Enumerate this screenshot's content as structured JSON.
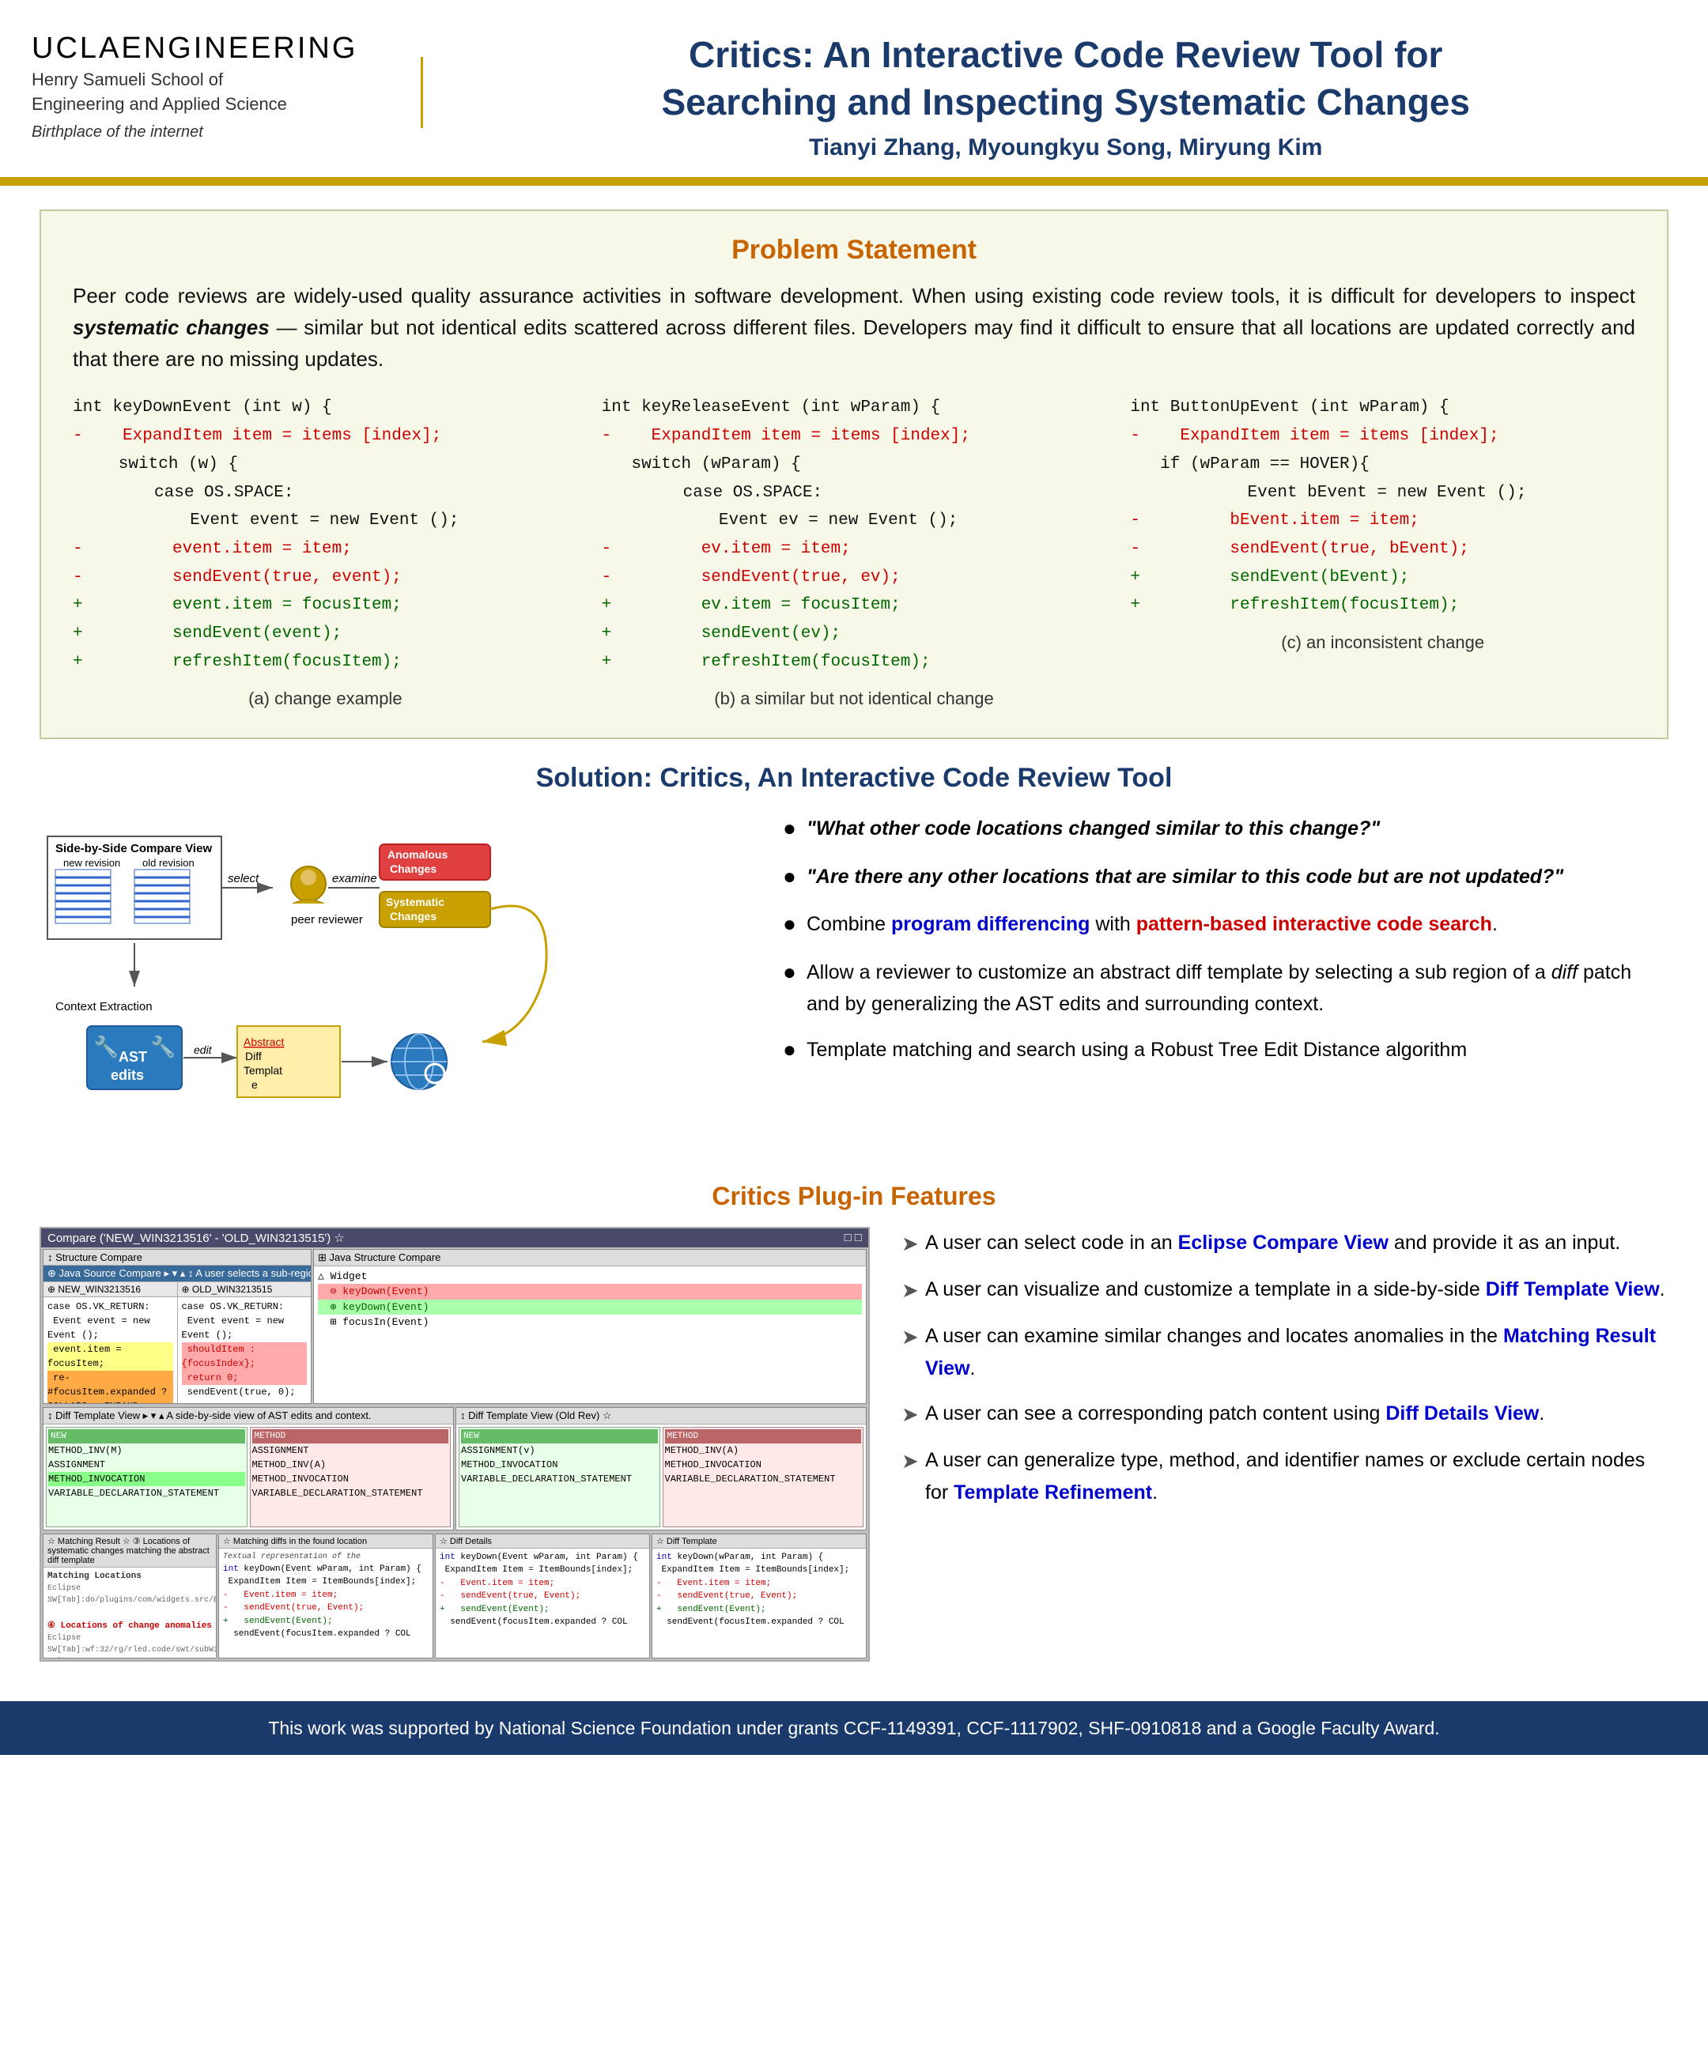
{
  "header": {
    "ucla_text": "UCLA",
    "engineering_text": "ENGINEERING",
    "school_line1": "Henry Samueli School of",
    "school_line2": "Engineering and Applied Science",
    "tagline": "Birthplace of the internet",
    "paper_title_line1": "Critics: An Interactive Code Review Tool for",
    "paper_title_line2": "Searching and Inspecting Systematic Changes",
    "authors": "Tianyi Zhang, Myoungkyu Song, Miryung Kim"
  },
  "problem_statement": {
    "section_title": "Problem Statement",
    "text": "Peer code reviews are widely-used quality assurance activities in software development. When using existing code review tools, it is difficult for developers to inspect systematic changes — similar but not identical edits scattered across different files. Developers may find it difficult to ensure that all locations are updated correctly and that there are no missing updates.",
    "code_block_a": {
      "caption": "(a) change example",
      "lines": [
        {
          "text": "int keyDownEvent (int w) {",
          "style": "normal"
        },
        {
          "text": "-   ExpandItem item = items [index];",
          "style": "deleted"
        },
        {
          "text": "    switch (w) {",
          "style": "normal"
        },
        {
          "text": "        case OS.SPACE:",
          "style": "normal"
        },
        {
          "text": "            Event event = new Event ();",
          "style": "normal"
        },
        {
          "text": "-           event.item = item;",
          "style": "deleted"
        },
        {
          "text": "-           sendEvent(true, event);",
          "style": "deleted"
        },
        {
          "text": "+           event.item = focusItem;",
          "style": "added"
        },
        {
          "text": "+           sendEvent(event);",
          "style": "added"
        },
        {
          "text": "+           refreshItem(focusItem);",
          "style": "added"
        }
      ]
    },
    "code_block_b": {
      "caption": "(b) a similar but not identical change",
      "lines": [
        {
          "text": "int keyReleaseEvent (int wParam) {",
          "style": "normal"
        },
        {
          "text": "-   ExpandItem item = items [index];",
          "style": "deleted"
        },
        {
          "text": "    switch (wParam) {",
          "style": "normal"
        },
        {
          "text": "        case OS.SPACE:",
          "style": "normal"
        },
        {
          "text": "            Event ev = new Event ();",
          "style": "normal"
        },
        {
          "text": "-           ev.item = item;",
          "style": "deleted"
        },
        {
          "text": "-           sendEvent(true, ev);",
          "style": "deleted"
        },
        {
          "text": "+           ev.item = focusItem;",
          "style": "added"
        },
        {
          "text": "+           sendEvent(ev);",
          "style": "added"
        },
        {
          "text": "+           refreshItem(focusItem);",
          "style": "added"
        }
      ]
    },
    "code_block_c": {
      "caption": "(c) an inconsistent change",
      "lines": [
        {
          "text": "int ButtonUpEvent (int wParam) {",
          "style": "normal"
        },
        {
          "text": "-   ExpandItem item = items [index];",
          "style": "deleted"
        },
        {
          "text": "    if (wParam == HOVER){",
          "style": "normal"
        },
        {
          "text": "        Event bEvent = new Event ();",
          "style": "normal"
        },
        {
          "text": "-       bEvent.item = item;",
          "style": "deleted"
        },
        {
          "text": "-       sendEvent(true, bEvent);",
          "style": "deleted"
        },
        {
          "text": "+       sendEvent(bEvent);",
          "style": "added"
        },
        {
          "text": "+       refreshItem(focusItem);",
          "style": "added"
        }
      ]
    }
  },
  "solution": {
    "section_title": "Solution: Critics, An Interactive Code Review Tool",
    "diagram": {
      "compare_view_label": "Side-by-Side Compare View",
      "new_revision_label": "new revision",
      "old_revision_label": "old revision",
      "select_label": "select",
      "examine_label": "examine",
      "edit_label": "edit",
      "peer_reviewer_label": "peer reviewer",
      "anomalous_label": "Anomalous\nChanges",
      "systematic_label": "Systematic\nChanges",
      "ast_edits_label": "AST\nedits",
      "abstract_diff_label": "Abstract\nDiff\nTemplat\ne",
      "context_extraction_label": "Context Extraction"
    },
    "bullets": [
      {
        "text": "\"What other code locations changed similar to this change?\"",
        "italic": true
      },
      {
        "text": "\"Are there any other locations that are similar to this code but are not updated?\"",
        "italic": true
      },
      {
        "text_parts": [
          {
            "text": "Combine ",
            "style": "normal"
          },
          {
            "text": "program differencing",
            "style": "blue"
          },
          {
            "text": " with ",
            "style": "normal"
          },
          {
            "text": "pattern-based interactive code search",
            "style": "red"
          },
          {
            "text": ".",
            "style": "normal"
          }
        ]
      },
      {
        "text": "Allow a reviewer to customize an abstract diff template by selecting a sub region of a diff patch and by generalizing the AST edits and surrounding context."
      },
      {
        "text": "Template matching and search using a Robust Tree Edit Distance algorithm"
      }
    ]
  },
  "plugin_features": {
    "section_title": "Critics Plug-in Features",
    "bullets": [
      {
        "text_parts": [
          {
            "text": "A user can select code in an ",
            "style": "normal"
          },
          {
            "text": "Eclipse Compare View",
            "style": "blue"
          },
          {
            "text": " and provide it as an input.",
            "style": "normal"
          }
        ]
      },
      {
        "text_parts": [
          {
            "text": "A user can visualize and customize a template in a side-by-side ",
            "style": "normal"
          },
          {
            "text": "Diff Template View",
            "style": "blue"
          },
          {
            "text": ".",
            "style": "normal"
          }
        ]
      },
      {
        "text_parts": [
          {
            "text": "A user can examine similar changes and locates anomalies in the ",
            "style": "normal"
          },
          {
            "text": "Matching Result View",
            "style": "blue"
          },
          {
            "text": ".",
            "style": "normal"
          }
        ]
      },
      {
        "text_parts": [
          {
            "text": "A user can see a corresponding patch content using ",
            "style": "normal"
          },
          {
            "text": "Diff Details View",
            "style": "blue"
          },
          {
            "text": ".",
            "style": "normal"
          }
        ]
      },
      {
        "text_parts": [
          {
            "text": "A user can generalize type, method, and identifier names or exclude certain nodes for ",
            "style": "normal"
          },
          {
            "text": "Template Refinement",
            "style": "blue"
          },
          {
            "text": ".",
            "style": "normal"
          }
        ]
      }
    ]
  },
  "footer": {
    "text": "This work was supported by National Science Foundation under grants CCF-1149391, CCF-1117902, SHF-0910818 and a Google Faculty Award."
  }
}
